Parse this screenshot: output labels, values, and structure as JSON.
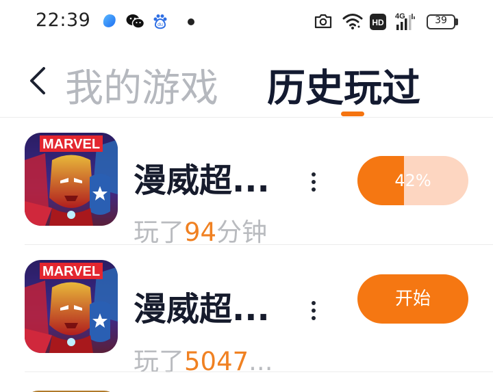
{
  "status_bar": {
    "time": "22:39",
    "battery": "39",
    "battery_level": 0.39,
    "left_icons": [
      "app-notification-icon",
      "wechat-icon",
      "baidu-icon",
      "dot-icon"
    ],
    "right_icons": [
      "camera-icon",
      "wifi-icon",
      "hd-icon",
      "signal-4g-icon",
      "battery-icon"
    ],
    "network_label": "4G",
    "hd_label": "HD"
  },
  "header": {
    "back_icon": "chevron-left-icon",
    "tabs": [
      {
        "label": "我的游戏",
        "active": false
      },
      {
        "label": "历史玩过",
        "active": true
      }
    ],
    "accent_color": "#f57410"
  },
  "games": [
    {
      "name": "漫威超...",
      "icon_label": "MARVEL",
      "playtime_prefix": "玩了",
      "playtime_value": "94",
      "playtime_suffix": "分钟",
      "action_type": "progress",
      "progress_label": "42%",
      "progress": 0.42
    },
    {
      "name": "漫威超...",
      "icon_label": "MARVEL",
      "playtime_prefix": "玩了",
      "playtime_value": "5047",
      "playtime_suffix": "...",
      "action_type": "start",
      "action_label": "开始"
    }
  ],
  "colors": {
    "accent": "#f57712",
    "accent_light": "#fdd6c1",
    "text_dark": "#161b2c",
    "text_muted": "#b9bbbf",
    "playtime_number": "#f08122"
  }
}
